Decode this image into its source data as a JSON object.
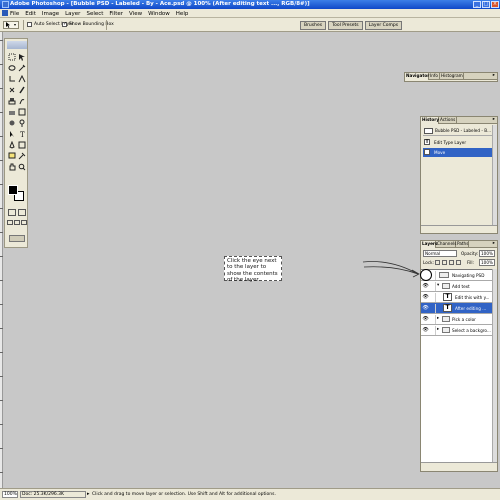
{
  "window": {
    "title": "Adobe Photoshop - [Bubble PSD - Labeled - By - Ace.psd @ 100% (After editing text ..., RGB/8#)]",
    "controls": [
      "_",
      "□",
      "×"
    ]
  },
  "menu": [
    "File",
    "Edit",
    "Image",
    "Layer",
    "Select",
    "Filter",
    "View",
    "Window",
    "Help"
  ],
  "options_bar": {
    "auto_select_layer": {
      "label": "Auto Select Layer",
      "checked": false
    },
    "show_bounding_box": {
      "label": "Show Bounding Box",
      "checked": true
    },
    "well_tabs": [
      "Brushes",
      "Tool Presets",
      "Layer Comps"
    ]
  },
  "callout": {
    "text": "Click the eye next to the layer to show the contents of the layer."
  },
  "navigator_panel": {
    "tabs": [
      "Navigator",
      "Info",
      "Histogram"
    ],
    "menu_arrow": "▸"
  },
  "history_panel": {
    "tabs": [
      "History",
      "Actions"
    ],
    "menu_arrow": "▸",
    "snapshot": "Bubble PSD - Labeled - B...",
    "states": [
      {
        "icon": "T",
        "label": "Edit Type Layer",
        "selected": false
      },
      {
        "icon": "",
        "label": "Move",
        "selected": true
      }
    ]
  },
  "layers_panel": {
    "tabs": [
      "Layers",
      "Channels",
      "Paths"
    ],
    "menu_arrow": "▸",
    "blend_mode": "Normal",
    "opacity_label": "Opacity:",
    "opacity_value": "100%",
    "lock_label": "Lock:",
    "fill_label": "Fill:",
    "fill_value": "100%",
    "layers": [
      {
        "name": "Navigating PSD",
        "kind": "image",
        "visible": false,
        "selected": false
      },
      {
        "name": "Add text",
        "kind": "group",
        "visible": true,
        "selected": false
      },
      {
        "name": "Edit this with y...",
        "kind": "text",
        "visible": true,
        "selected": false
      },
      {
        "name": "After editing ...",
        "kind": "text",
        "visible": true,
        "selected": true
      },
      {
        "name": "Pick a color",
        "kind": "group",
        "visible": true,
        "selected": false
      },
      {
        "name": "Select a backgro...",
        "kind": "group",
        "visible": true,
        "selected": false
      }
    ]
  },
  "status_bar": {
    "zoom": "100%",
    "doc": "Doc: 25.3K/296.3K",
    "hint": "Click and drag to move layer or selection.  Use Shift and Alt for additional options."
  }
}
